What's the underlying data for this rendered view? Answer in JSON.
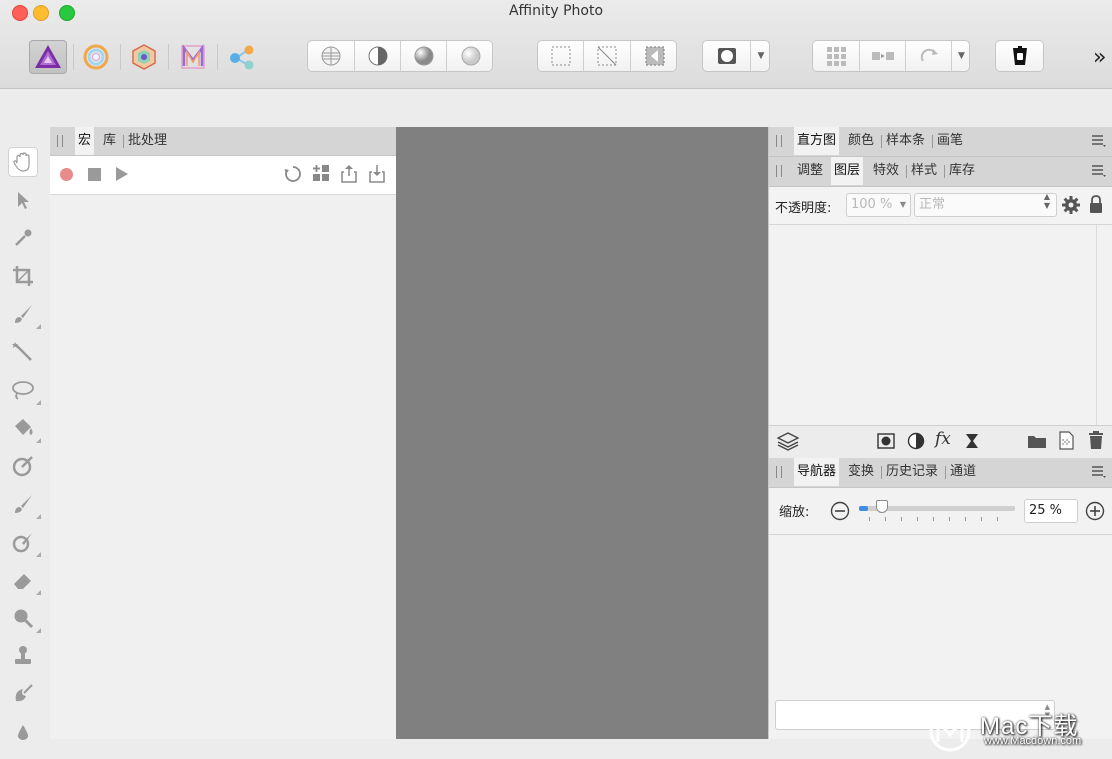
{
  "window": {
    "title": "Affinity Photo"
  },
  "toolbar": {
    "more_glyph": "»"
  },
  "left_panel": {
    "tabs": [
      {
        "label": "宏"
      },
      {
        "label": "库"
      },
      {
        "label": "批处理"
      }
    ]
  },
  "right_panel_1": {
    "tabs": [
      {
        "label": "直方图"
      },
      {
        "label": "颜色"
      },
      {
        "label": "样本条"
      },
      {
        "label": "画笔"
      }
    ]
  },
  "right_panel_2": {
    "tabs": [
      {
        "label": "调整"
      },
      {
        "label": "图层"
      },
      {
        "label": "特效"
      },
      {
        "label": "样式"
      },
      {
        "label": "库存"
      }
    ],
    "opacity_label": "不透明度:",
    "opacity_value": "100 %",
    "blend_mode": "正常",
    "fx_label": "fx"
  },
  "right_panel_3": {
    "tabs": [
      {
        "label": "导航器"
      },
      {
        "label": "变换"
      },
      {
        "label": "历史记录"
      },
      {
        "label": "通道"
      }
    ],
    "zoom_label": "缩放:",
    "zoom_value": "25 %",
    "zoom_fraction": 0.06
  },
  "watermark": {
    "brand": "Mac下载",
    "url": "www.Macdown.com"
  },
  "colors": {
    "canvas": "#808080",
    "accent_red": "#e88b8b"
  }
}
